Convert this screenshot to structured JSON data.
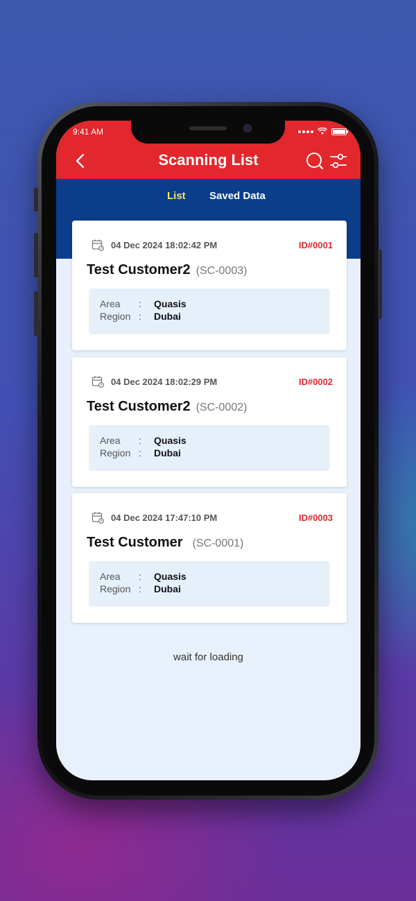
{
  "status": {
    "time": "9:41 AM"
  },
  "header": {
    "title": "Scanning List"
  },
  "tabs": [
    {
      "label": "List",
      "active": true
    },
    {
      "label": "Saved Data",
      "active": false
    }
  ],
  "records": [
    {
      "date": "04 Dec 2024 18:02:42 PM",
      "id": "ID#0001",
      "name": "Test Customer2",
      "code": "(SC-0003)",
      "area_label": "Area",
      "area": "Quasis",
      "region_label": "Region",
      "region": "Dubai"
    },
    {
      "date": "04 Dec 2024 18:02:29 PM",
      "id": "ID#0002",
      "name": "Test Customer2",
      "code": "(SC-0002)",
      "area_label": "Area",
      "area": "Quasis",
      "region_label": "Region",
      "region": "Dubai"
    },
    {
      "date": "04 Dec 2024 17:47:10 PM",
      "id": "ID#0003",
      "name": "Test Customer",
      "code": "(SC-0001)",
      "area_label": "Area",
      "area": "Quasis",
      "region_label": "Region",
      "region": "Dubai"
    }
  ],
  "footer": {
    "loading_text": "wait for loading"
  },
  "colors": {
    "primary_red": "#e2272d",
    "tab_blue": "#0b3d8a",
    "active_tab": "#f4e76b",
    "background": "#e8f1fb"
  },
  "icons": [
    "back-icon",
    "search-icon",
    "filter-icon",
    "calendar-icon"
  ]
}
